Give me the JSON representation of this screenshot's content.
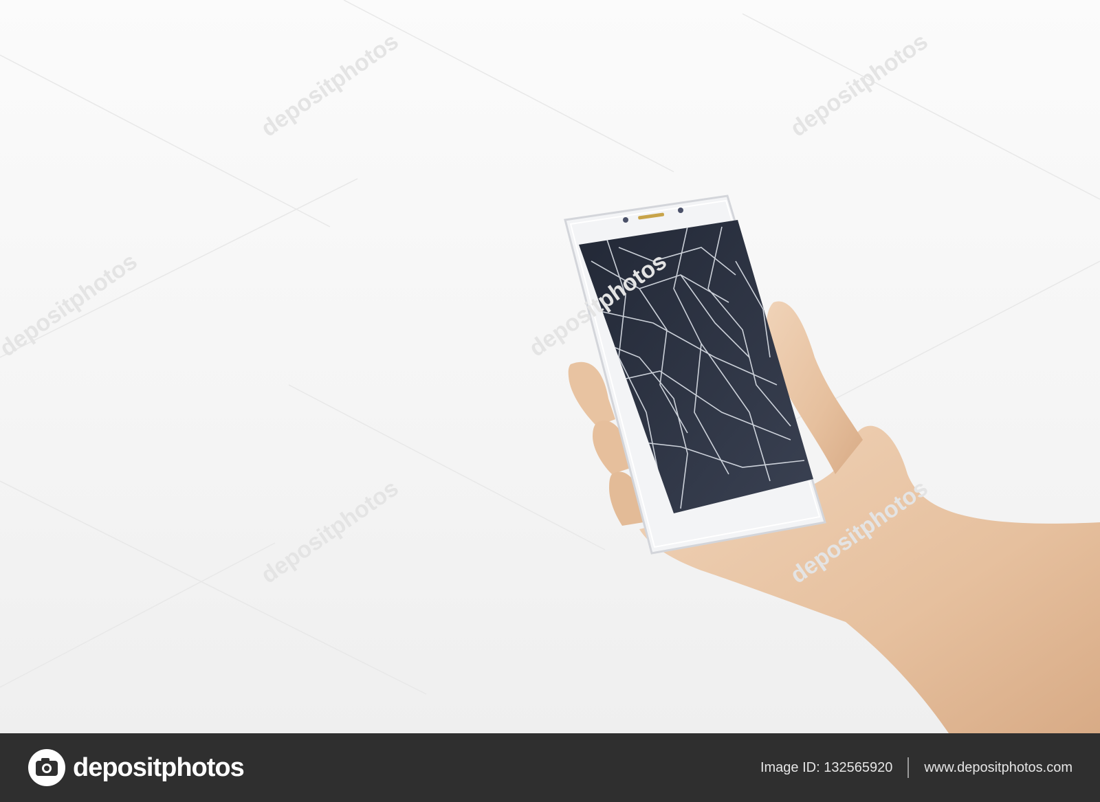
{
  "photo": {
    "subject_icon": "cracked-smartphone-in-hand",
    "watermark_text": "depositphotos",
    "colors": {
      "background": "#f5f5f5",
      "phone_body": "#f2f3f5",
      "screen": "#2c3140",
      "skin": "#e9c7a6",
      "footer": "#2f2f2f"
    }
  },
  "footer": {
    "logo_icon": "camera-icon",
    "brand_name": "depositphotos",
    "image_id_label": "Image ID:",
    "image_id": "132565920",
    "website": "www.depositphotos.com"
  }
}
